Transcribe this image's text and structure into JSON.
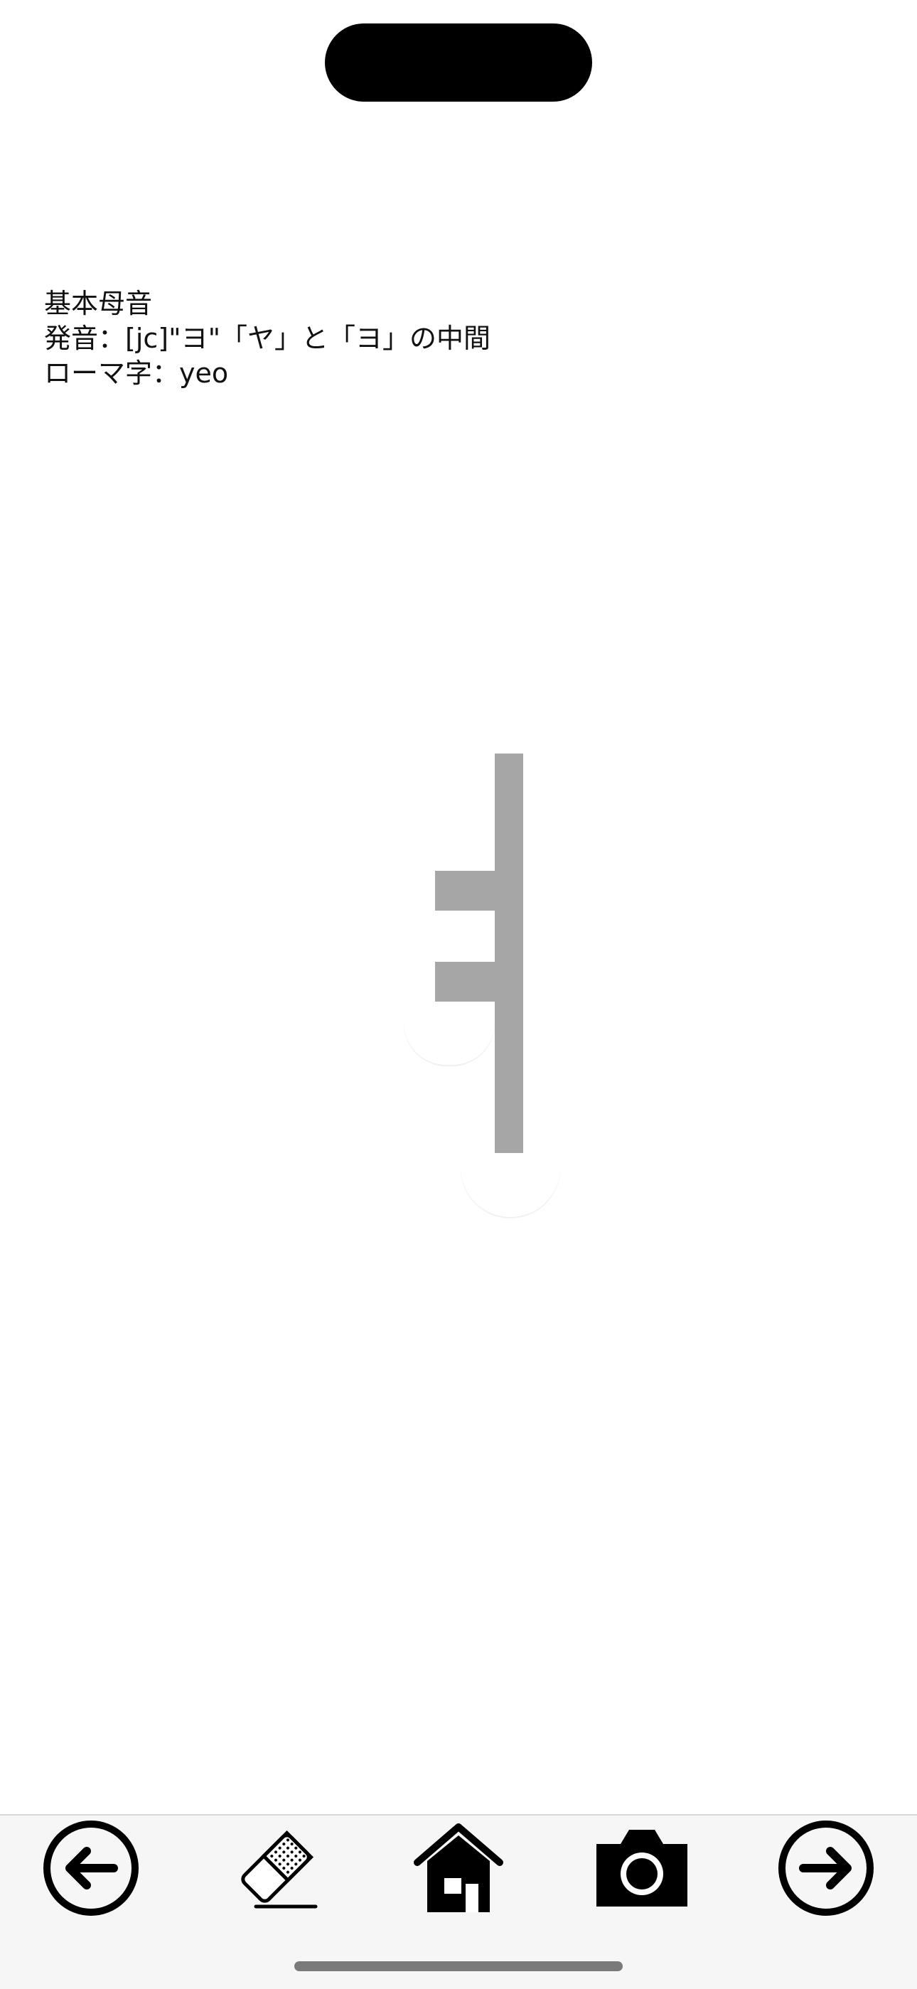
{
  "info": {
    "category": "基本母音",
    "pronunciation": "発音：[jc]\"ヨ\"「ヤ」と「ヨ」の中間",
    "romanization": "ローマ字：yeo"
  },
  "toolbar": {
    "buttons": [
      {
        "icon": "arrow-left-circle-icon"
      },
      {
        "icon": "eraser-icon"
      },
      {
        "icon": "home-icon"
      },
      {
        "icon": "camera-icon"
      },
      {
        "icon": "arrow-right-circle-icon"
      }
    ]
  },
  "colors": {
    "stroke_guide": "#a6a6a6",
    "toolbar_bg": "#f6f6f6",
    "icon": "#000000"
  }
}
